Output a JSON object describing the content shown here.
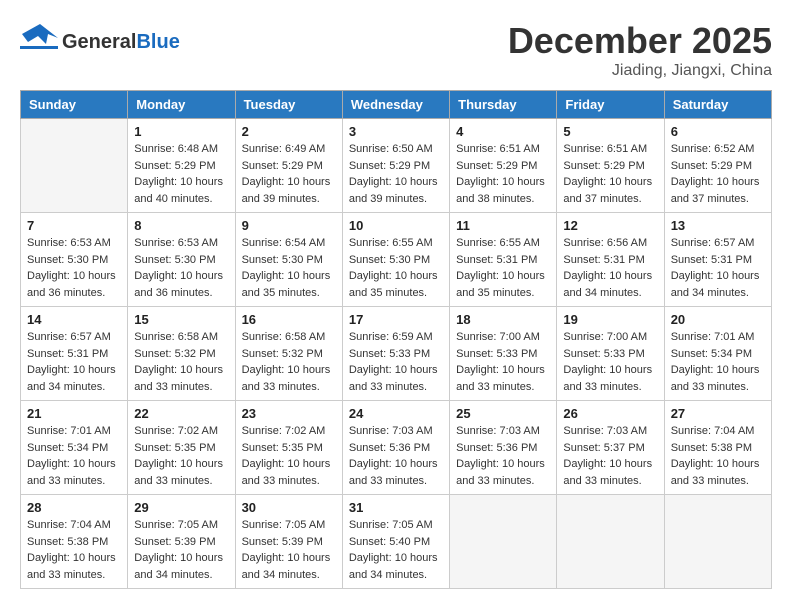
{
  "header": {
    "logo": {
      "general": "General",
      "blue": "Blue"
    },
    "title": "December 2025",
    "location": "Jiading, Jiangxi, China"
  },
  "weekdays": [
    "Sunday",
    "Monday",
    "Tuesday",
    "Wednesday",
    "Thursday",
    "Friday",
    "Saturday"
  ],
  "weeks": [
    [
      {
        "day": "",
        "empty": true
      },
      {
        "day": "1",
        "sunrise": "6:48 AM",
        "sunset": "5:29 PM",
        "daylight": "10 hours and 40 minutes."
      },
      {
        "day": "2",
        "sunrise": "6:49 AM",
        "sunset": "5:29 PM",
        "daylight": "10 hours and 39 minutes."
      },
      {
        "day": "3",
        "sunrise": "6:50 AM",
        "sunset": "5:29 PM",
        "daylight": "10 hours and 39 minutes."
      },
      {
        "day": "4",
        "sunrise": "6:51 AM",
        "sunset": "5:29 PM",
        "daylight": "10 hours and 38 minutes."
      },
      {
        "day": "5",
        "sunrise": "6:51 AM",
        "sunset": "5:29 PM",
        "daylight": "10 hours and 37 minutes."
      },
      {
        "day": "6",
        "sunrise": "6:52 AM",
        "sunset": "5:29 PM",
        "daylight": "10 hours and 37 minutes."
      }
    ],
    [
      {
        "day": "7",
        "sunrise": "6:53 AM",
        "sunset": "5:30 PM",
        "daylight": "10 hours and 36 minutes."
      },
      {
        "day": "8",
        "sunrise": "6:53 AM",
        "sunset": "5:30 PM",
        "daylight": "10 hours and 36 minutes."
      },
      {
        "day": "9",
        "sunrise": "6:54 AM",
        "sunset": "5:30 PM",
        "daylight": "10 hours and 35 minutes."
      },
      {
        "day": "10",
        "sunrise": "6:55 AM",
        "sunset": "5:30 PM",
        "daylight": "10 hours and 35 minutes."
      },
      {
        "day": "11",
        "sunrise": "6:55 AM",
        "sunset": "5:31 PM",
        "daylight": "10 hours and 35 minutes."
      },
      {
        "day": "12",
        "sunrise": "6:56 AM",
        "sunset": "5:31 PM",
        "daylight": "10 hours and 34 minutes."
      },
      {
        "day": "13",
        "sunrise": "6:57 AM",
        "sunset": "5:31 PM",
        "daylight": "10 hours and 34 minutes."
      }
    ],
    [
      {
        "day": "14",
        "sunrise": "6:57 AM",
        "sunset": "5:31 PM",
        "daylight": "10 hours and 34 minutes."
      },
      {
        "day": "15",
        "sunrise": "6:58 AM",
        "sunset": "5:32 PM",
        "daylight": "10 hours and 33 minutes."
      },
      {
        "day": "16",
        "sunrise": "6:58 AM",
        "sunset": "5:32 PM",
        "daylight": "10 hours and 33 minutes."
      },
      {
        "day": "17",
        "sunrise": "6:59 AM",
        "sunset": "5:33 PM",
        "daylight": "10 hours and 33 minutes."
      },
      {
        "day": "18",
        "sunrise": "7:00 AM",
        "sunset": "5:33 PM",
        "daylight": "10 hours and 33 minutes."
      },
      {
        "day": "19",
        "sunrise": "7:00 AM",
        "sunset": "5:33 PM",
        "daylight": "10 hours and 33 minutes."
      },
      {
        "day": "20",
        "sunrise": "7:01 AM",
        "sunset": "5:34 PM",
        "daylight": "10 hours and 33 minutes."
      }
    ],
    [
      {
        "day": "21",
        "sunrise": "7:01 AM",
        "sunset": "5:34 PM",
        "daylight": "10 hours and 33 minutes."
      },
      {
        "day": "22",
        "sunrise": "7:02 AM",
        "sunset": "5:35 PM",
        "daylight": "10 hours and 33 minutes."
      },
      {
        "day": "23",
        "sunrise": "7:02 AM",
        "sunset": "5:35 PM",
        "daylight": "10 hours and 33 minutes."
      },
      {
        "day": "24",
        "sunrise": "7:03 AM",
        "sunset": "5:36 PM",
        "daylight": "10 hours and 33 minutes."
      },
      {
        "day": "25",
        "sunrise": "7:03 AM",
        "sunset": "5:36 PM",
        "daylight": "10 hours and 33 minutes."
      },
      {
        "day": "26",
        "sunrise": "7:03 AM",
        "sunset": "5:37 PM",
        "daylight": "10 hours and 33 minutes."
      },
      {
        "day": "27",
        "sunrise": "7:04 AM",
        "sunset": "5:38 PM",
        "daylight": "10 hours and 33 minutes."
      }
    ],
    [
      {
        "day": "28",
        "sunrise": "7:04 AM",
        "sunset": "5:38 PM",
        "daylight": "10 hours and 33 minutes."
      },
      {
        "day": "29",
        "sunrise": "7:05 AM",
        "sunset": "5:39 PM",
        "daylight": "10 hours and 34 minutes."
      },
      {
        "day": "30",
        "sunrise": "7:05 AM",
        "sunset": "5:39 PM",
        "daylight": "10 hours and 34 minutes."
      },
      {
        "day": "31",
        "sunrise": "7:05 AM",
        "sunset": "5:40 PM",
        "daylight": "10 hours and 34 minutes."
      },
      {
        "day": "",
        "empty": true
      },
      {
        "day": "",
        "empty": true
      },
      {
        "day": "",
        "empty": true
      }
    ]
  ],
  "labels": {
    "sunrise": "Sunrise:",
    "sunset": "Sunset:",
    "daylight": "Daylight:"
  }
}
